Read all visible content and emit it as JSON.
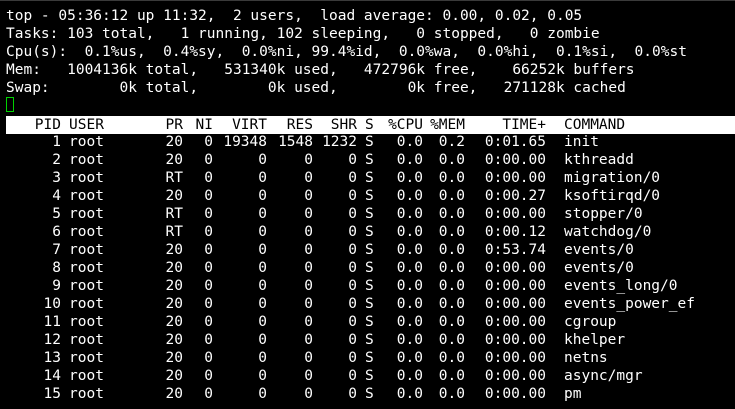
{
  "summary": {
    "line1": "top - 05:36:12 up 11:32,  2 users,  load average: 0.00, 0.02, 0.05",
    "line2": "Tasks: 103 total,   1 running, 102 sleeping,   0 stopped,   0 zombie",
    "line3": "Cpu(s):  0.1%us,  0.4%sy,  0.0%ni, 99.4%id,  0.0%wa,  0.0%hi,  0.1%si,  0.0%st",
    "line4": "Mem:   1004136k total,   531340k used,   472796k free,    66252k buffers",
    "line5": "Swap:        0k total,        0k used,        0k free,   271128k cached"
  },
  "columns": {
    "pid": "PID",
    "user": "USER",
    "pr": "PR",
    "ni": "NI",
    "virt": "VIRT",
    "res": "RES",
    "shr": "SHR",
    "s": "S",
    "cpu": "%CPU",
    "mem": "%MEM",
    "time": "TIME+",
    "command": "COMMAND"
  },
  "processes": [
    {
      "pid": "1",
      "user": "root",
      "pr": "20",
      "ni": "0",
      "virt": "19348",
      "res": "1548",
      "shr": "1232",
      "s": "S",
      "cpu": "0.0",
      "mem": "0.2",
      "time": "0:01.65",
      "command": "init"
    },
    {
      "pid": "2",
      "user": "root",
      "pr": "20",
      "ni": "0",
      "virt": "0",
      "res": "0",
      "shr": "0",
      "s": "S",
      "cpu": "0.0",
      "mem": "0.0",
      "time": "0:00.00",
      "command": "kthreadd"
    },
    {
      "pid": "3",
      "user": "root",
      "pr": "RT",
      "ni": "0",
      "virt": "0",
      "res": "0",
      "shr": "0",
      "s": "S",
      "cpu": "0.0",
      "mem": "0.0",
      "time": "0:00.00",
      "command": "migration/0"
    },
    {
      "pid": "4",
      "user": "root",
      "pr": "20",
      "ni": "0",
      "virt": "0",
      "res": "0",
      "shr": "0",
      "s": "S",
      "cpu": "0.0",
      "mem": "0.0",
      "time": "0:00.27",
      "command": "ksoftirqd/0"
    },
    {
      "pid": "5",
      "user": "root",
      "pr": "RT",
      "ni": "0",
      "virt": "0",
      "res": "0",
      "shr": "0",
      "s": "S",
      "cpu": "0.0",
      "mem": "0.0",
      "time": "0:00.00",
      "command": "stopper/0"
    },
    {
      "pid": "6",
      "user": "root",
      "pr": "RT",
      "ni": "0",
      "virt": "0",
      "res": "0",
      "shr": "0",
      "s": "S",
      "cpu": "0.0",
      "mem": "0.0",
      "time": "0:00.12",
      "command": "watchdog/0"
    },
    {
      "pid": "7",
      "user": "root",
      "pr": "20",
      "ni": "0",
      "virt": "0",
      "res": "0",
      "shr": "0",
      "s": "S",
      "cpu": "0.0",
      "mem": "0.0",
      "time": "0:53.74",
      "command": "events/0"
    },
    {
      "pid": "8",
      "user": "root",
      "pr": "20",
      "ni": "0",
      "virt": "0",
      "res": "0",
      "shr": "0",
      "s": "S",
      "cpu": "0.0",
      "mem": "0.0",
      "time": "0:00.00",
      "command": "events/0"
    },
    {
      "pid": "9",
      "user": "root",
      "pr": "20",
      "ni": "0",
      "virt": "0",
      "res": "0",
      "shr": "0",
      "s": "S",
      "cpu": "0.0",
      "mem": "0.0",
      "time": "0:00.00",
      "command": "events_long/0"
    },
    {
      "pid": "10",
      "user": "root",
      "pr": "20",
      "ni": "0",
      "virt": "0",
      "res": "0",
      "shr": "0",
      "s": "S",
      "cpu": "0.0",
      "mem": "0.0",
      "time": "0:00.00",
      "command": "events_power_ef"
    },
    {
      "pid": "11",
      "user": "root",
      "pr": "20",
      "ni": "0",
      "virt": "0",
      "res": "0",
      "shr": "0",
      "s": "S",
      "cpu": "0.0",
      "mem": "0.0",
      "time": "0:00.00",
      "command": "cgroup"
    },
    {
      "pid": "12",
      "user": "root",
      "pr": "20",
      "ni": "0",
      "virt": "0",
      "res": "0",
      "shr": "0",
      "s": "S",
      "cpu": "0.0",
      "mem": "0.0",
      "time": "0:00.00",
      "command": "khelper"
    },
    {
      "pid": "13",
      "user": "root",
      "pr": "20",
      "ni": "0",
      "virt": "0",
      "res": "0",
      "shr": "0",
      "s": "S",
      "cpu": "0.0",
      "mem": "0.0",
      "time": "0:00.00",
      "command": "netns"
    },
    {
      "pid": "14",
      "user": "root",
      "pr": "20",
      "ni": "0",
      "virt": "0",
      "res": "0",
      "shr": "0",
      "s": "S",
      "cpu": "0.0",
      "mem": "0.0",
      "time": "0:00.00",
      "command": "async/mgr"
    },
    {
      "pid": "15",
      "user": "root",
      "pr": "20",
      "ni": "0",
      "virt": "0",
      "res": "0",
      "shr": "0",
      "s": "S",
      "cpu": "0.0",
      "mem": "0.0",
      "time": "0:00.00",
      "command": "pm"
    }
  ],
  "colors": {
    "background": "#000000",
    "text": "#ffffff",
    "header_bar_bg": "#ffffff",
    "header_bar_text": "#000000",
    "cursor": "#00d200"
  }
}
